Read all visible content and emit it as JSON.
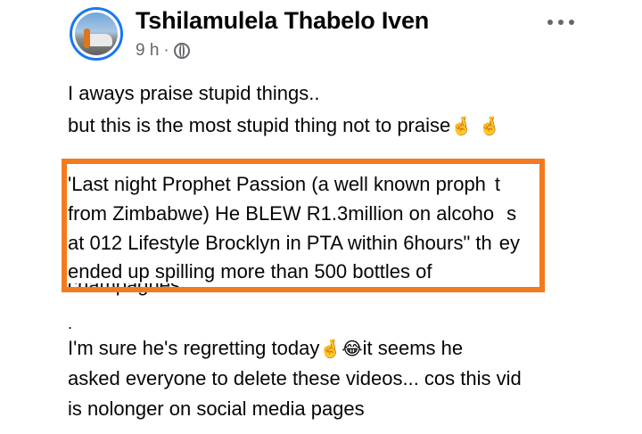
{
  "post": {
    "author": "Tshilamulela Thabelo Iven",
    "time": "9 h",
    "dot": "·",
    "privacy_icon": "globe-icon",
    "more_icon": "more-options-icon",
    "intro_line_1": "I aways praise stupid things..",
    "intro_line_2": "but this is the most stupid thing not to praise",
    "intro_emoji": "🤞 🤞",
    "quote_lines": [
      "'Last night Prophet Passion (a well known proph",
      "t",
      "from Zimbabwe) He BLEW R1.3million on alcoho",
      "s",
      "at 012 Lifestyle Brocklyn in PTA within 6hours\" th",
      "ey",
      "ended up spilling more than 500 bottles of"
    ],
    "quote_cut_line": "champagnes..",
    "separator": ".",
    "outro_line_1_a": "I'm sure he's regretting today",
    "outro_emoji": "🤞😂",
    "outro_line_1_b": "it seems he",
    "outro_line_2": "asked everyone to delete these videos... cos this vid",
    "outro_line_3": "is nolonger on social media pages"
  },
  "colors": {
    "highlight_border": "#f47a20",
    "avatar_ring": "#1877f2",
    "meta_text": "#65676b"
  }
}
